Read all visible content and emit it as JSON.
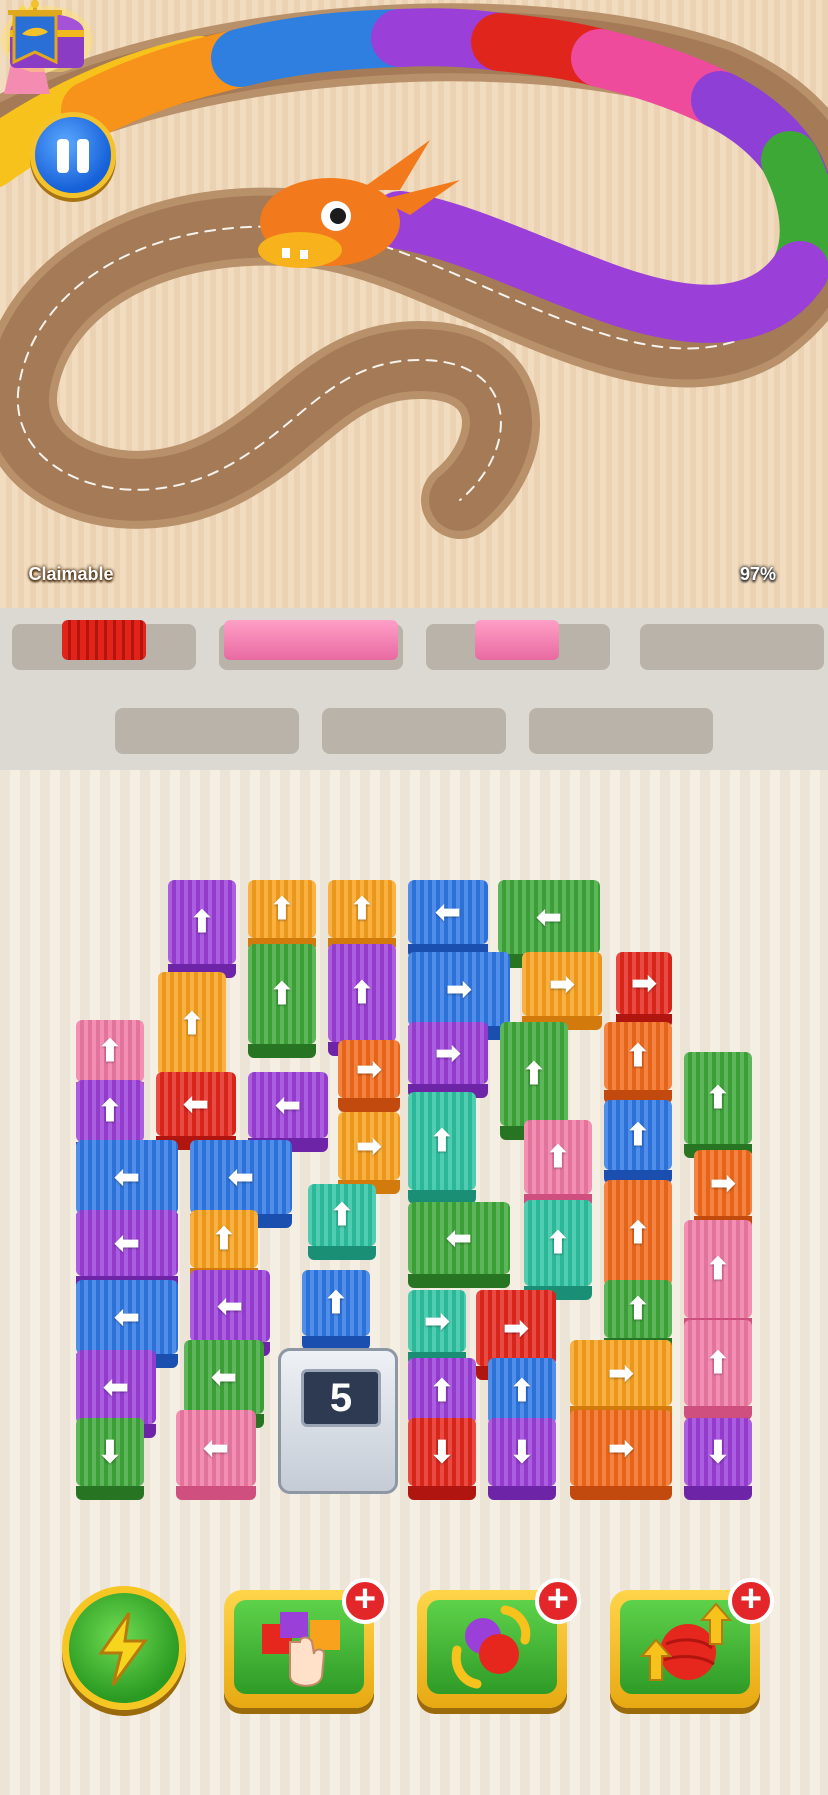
{
  "hud": {
    "chest_label": "Claimable",
    "progress_percent": "97%"
  },
  "icons": {
    "pause": "pause-icon",
    "chest": "treasure-chest-icon",
    "banner": "dragon-banner-icon",
    "princess": "princess-figure",
    "dragon": "dragon-head"
  },
  "spools": [
    {
      "color": "#e2231a",
      "state": "red-spool"
    },
    {
      "color": "#f27fb0",
      "state": "pink-spool"
    },
    {
      "color": "#f27fb0",
      "state": "pink-spool-small"
    },
    {
      "color": "",
      "state": "empty"
    },
    {
      "color": "",
      "state": "empty"
    },
    {
      "color": "",
      "state": "empty"
    },
    {
      "color": "",
      "state": "empty"
    }
  ],
  "board": {
    "counter_value": "5"
  },
  "arrows": {
    "up": "⬆",
    "down": "⬇",
    "left": "⬅",
    "right": "➡"
  },
  "boosters": [
    {
      "name": "lightning-booster",
      "icon": "lightning-bolt-icon"
    },
    {
      "name": "select-tile-booster",
      "icon": "tap-hand-icon"
    },
    {
      "name": "swap-yarn-booster",
      "icon": "swap-arrows-icon"
    },
    {
      "name": "upgrade-yarn-booster",
      "icon": "yarn-ball-up-icon"
    }
  ],
  "colors": {
    "purple": "#9b3fd9",
    "orange": "#f9a21e",
    "deeporange": "#f26a1b",
    "blue": "#2f78e6",
    "green": "#3fa83a",
    "red": "#e5271d",
    "pink": "#f07aa4",
    "teal": "#2ec4a2"
  }
}
